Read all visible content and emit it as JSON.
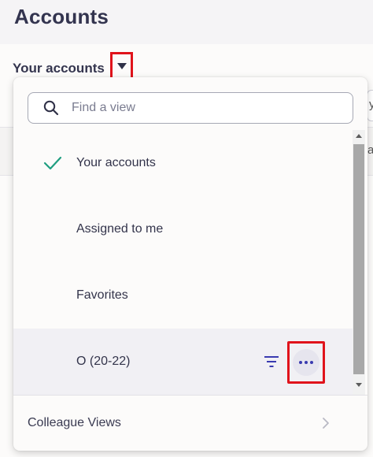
{
  "header": {
    "title": "Accounts"
  },
  "view_selector": {
    "label": "Your accounts"
  },
  "search": {
    "placeholder": "Find a view"
  },
  "views": {
    "items": [
      {
        "label": "Your accounts",
        "selected": true
      },
      {
        "label": "Assigned to me",
        "selected": false
      },
      {
        "label": "Favorites",
        "selected": false
      },
      {
        "label": "O (20-22)",
        "selected": false,
        "hovered": true
      }
    ]
  },
  "footer": {
    "label": "Colleague Views"
  },
  "background": {
    "clipped_letter": "y",
    "clipped_letter2": "a"
  },
  "colors": {
    "accent": "#3a3bb0",
    "check": "#1f9e80",
    "highlight_box": "#e0131b",
    "title": "#33344f"
  },
  "icons": {
    "search": "search-icon",
    "check": "check-icon",
    "filter": "filter-icon",
    "more": "more-horizontal-icon",
    "caret": "caret-down-icon",
    "chevron": "chevron-right-icon"
  }
}
